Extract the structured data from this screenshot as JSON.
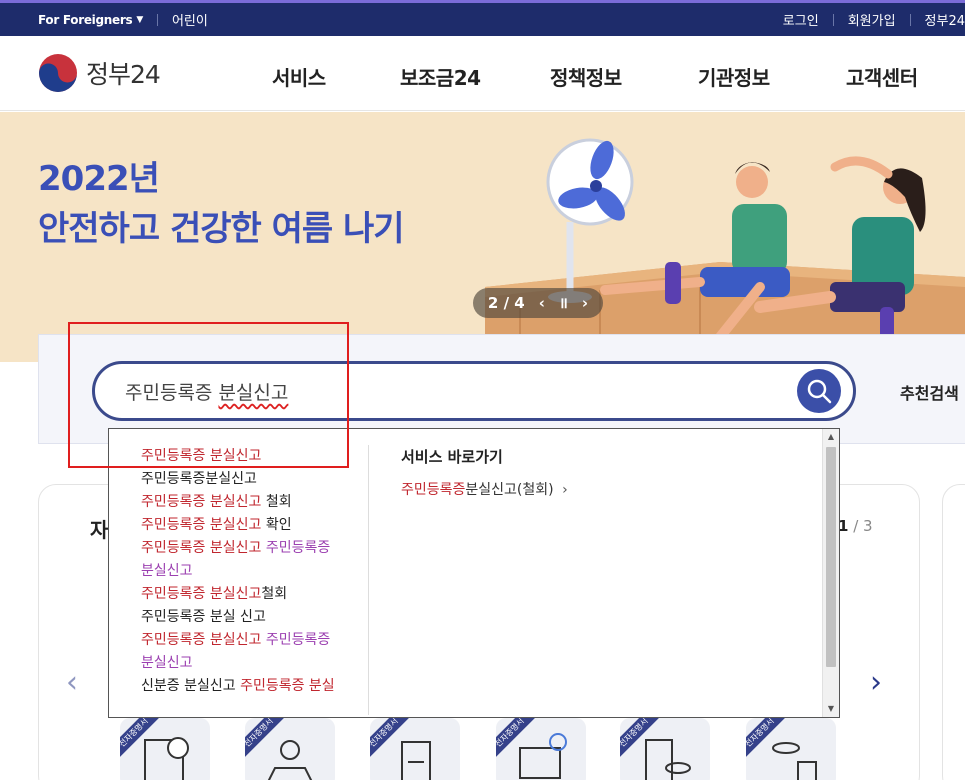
{
  "utility": {
    "foreigners": "For Foreigners",
    "kids": "어린이",
    "login": "로그인",
    "signup": "회원가입",
    "gov24": "정부24"
  },
  "header": {
    "logo_text": "정부24",
    "nav": [
      "서비스",
      "보조금24",
      "정책정보",
      "기관정보",
      "고객센터"
    ]
  },
  "banner": {
    "line1": "2022년",
    "line2": "안전하고 건강한 여름 나기",
    "pager_current": "2",
    "pager_total": "4",
    "pager_text": "2 / 4"
  },
  "search": {
    "prefix": "주민등록증 ",
    "misspelled": "분실신고",
    "recommend_label": "추천검색"
  },
  "autocomplete": {
    "shortcut_title": "서비스 바로가기",
    "shortcut_hl": "주민등록증",
    "shortcut_rest": "분실신고(철회)",
    "shortcut_chevron": "›",
    "items": [
      {
        "hl": "주민등록증 분실신고",
        "rest": "",
        "pu": "",
        "pu2": ""
      },
      {
        "hl": "",
        "rest": "주민등록증분실신고",
        "pu": "",
        "pu2": ""
      },
      {
        "hl": "주민등록증 분실신고",
        "rest": " 철회",
        "pu": "",
        "pu2": ""
      },
      {
        "hl": "주민등록증 분실신고",
        "rest": " 확인",
        "pu": "",
        "pu2": ""
      },
      {
        "hl": "주민등록증 분실신고",
        "rest": " ",
        "pu": "주민등록증",
        "pu2": "분실신고"
      },
      {
        "hl": "주민등록증 분실신고",
        "rest": "철회",
        "pu": "",
        "pu2": ""
      },
      {
        "hl": "",
        "rest": "주민등록증 분실 신고",
        "pu": "",
        "pu2": ""
      },
      {
        "hl": "주민등록증 분실신고",
        "rest": " ",
        "pu": "주민등록증",
        "pu2": "분실신고"
      },
      {
        "hl": "",
        "rest": "신분증 분실신고 ",
        "pu": "",
        "pu2": "",
        "hl2": "주민등록증 분실"
      }
    ]
  },
  "cards": {
    "heading": "자",
    "page_current": "1",
    "page_total": " / 3",
    "badge": "전자증명서",
    "prev": "‹",
    "next": "›"
  },
  "colors": {
    "utility_bg": "#1e2c6b",
    "brand_blue": "#3a4fb7",
    "banner_bg": "#f6e4c6",
    "highlight_red": "#c0262e",
    "highlight_purple": "#9b3fb0"
  }
}
